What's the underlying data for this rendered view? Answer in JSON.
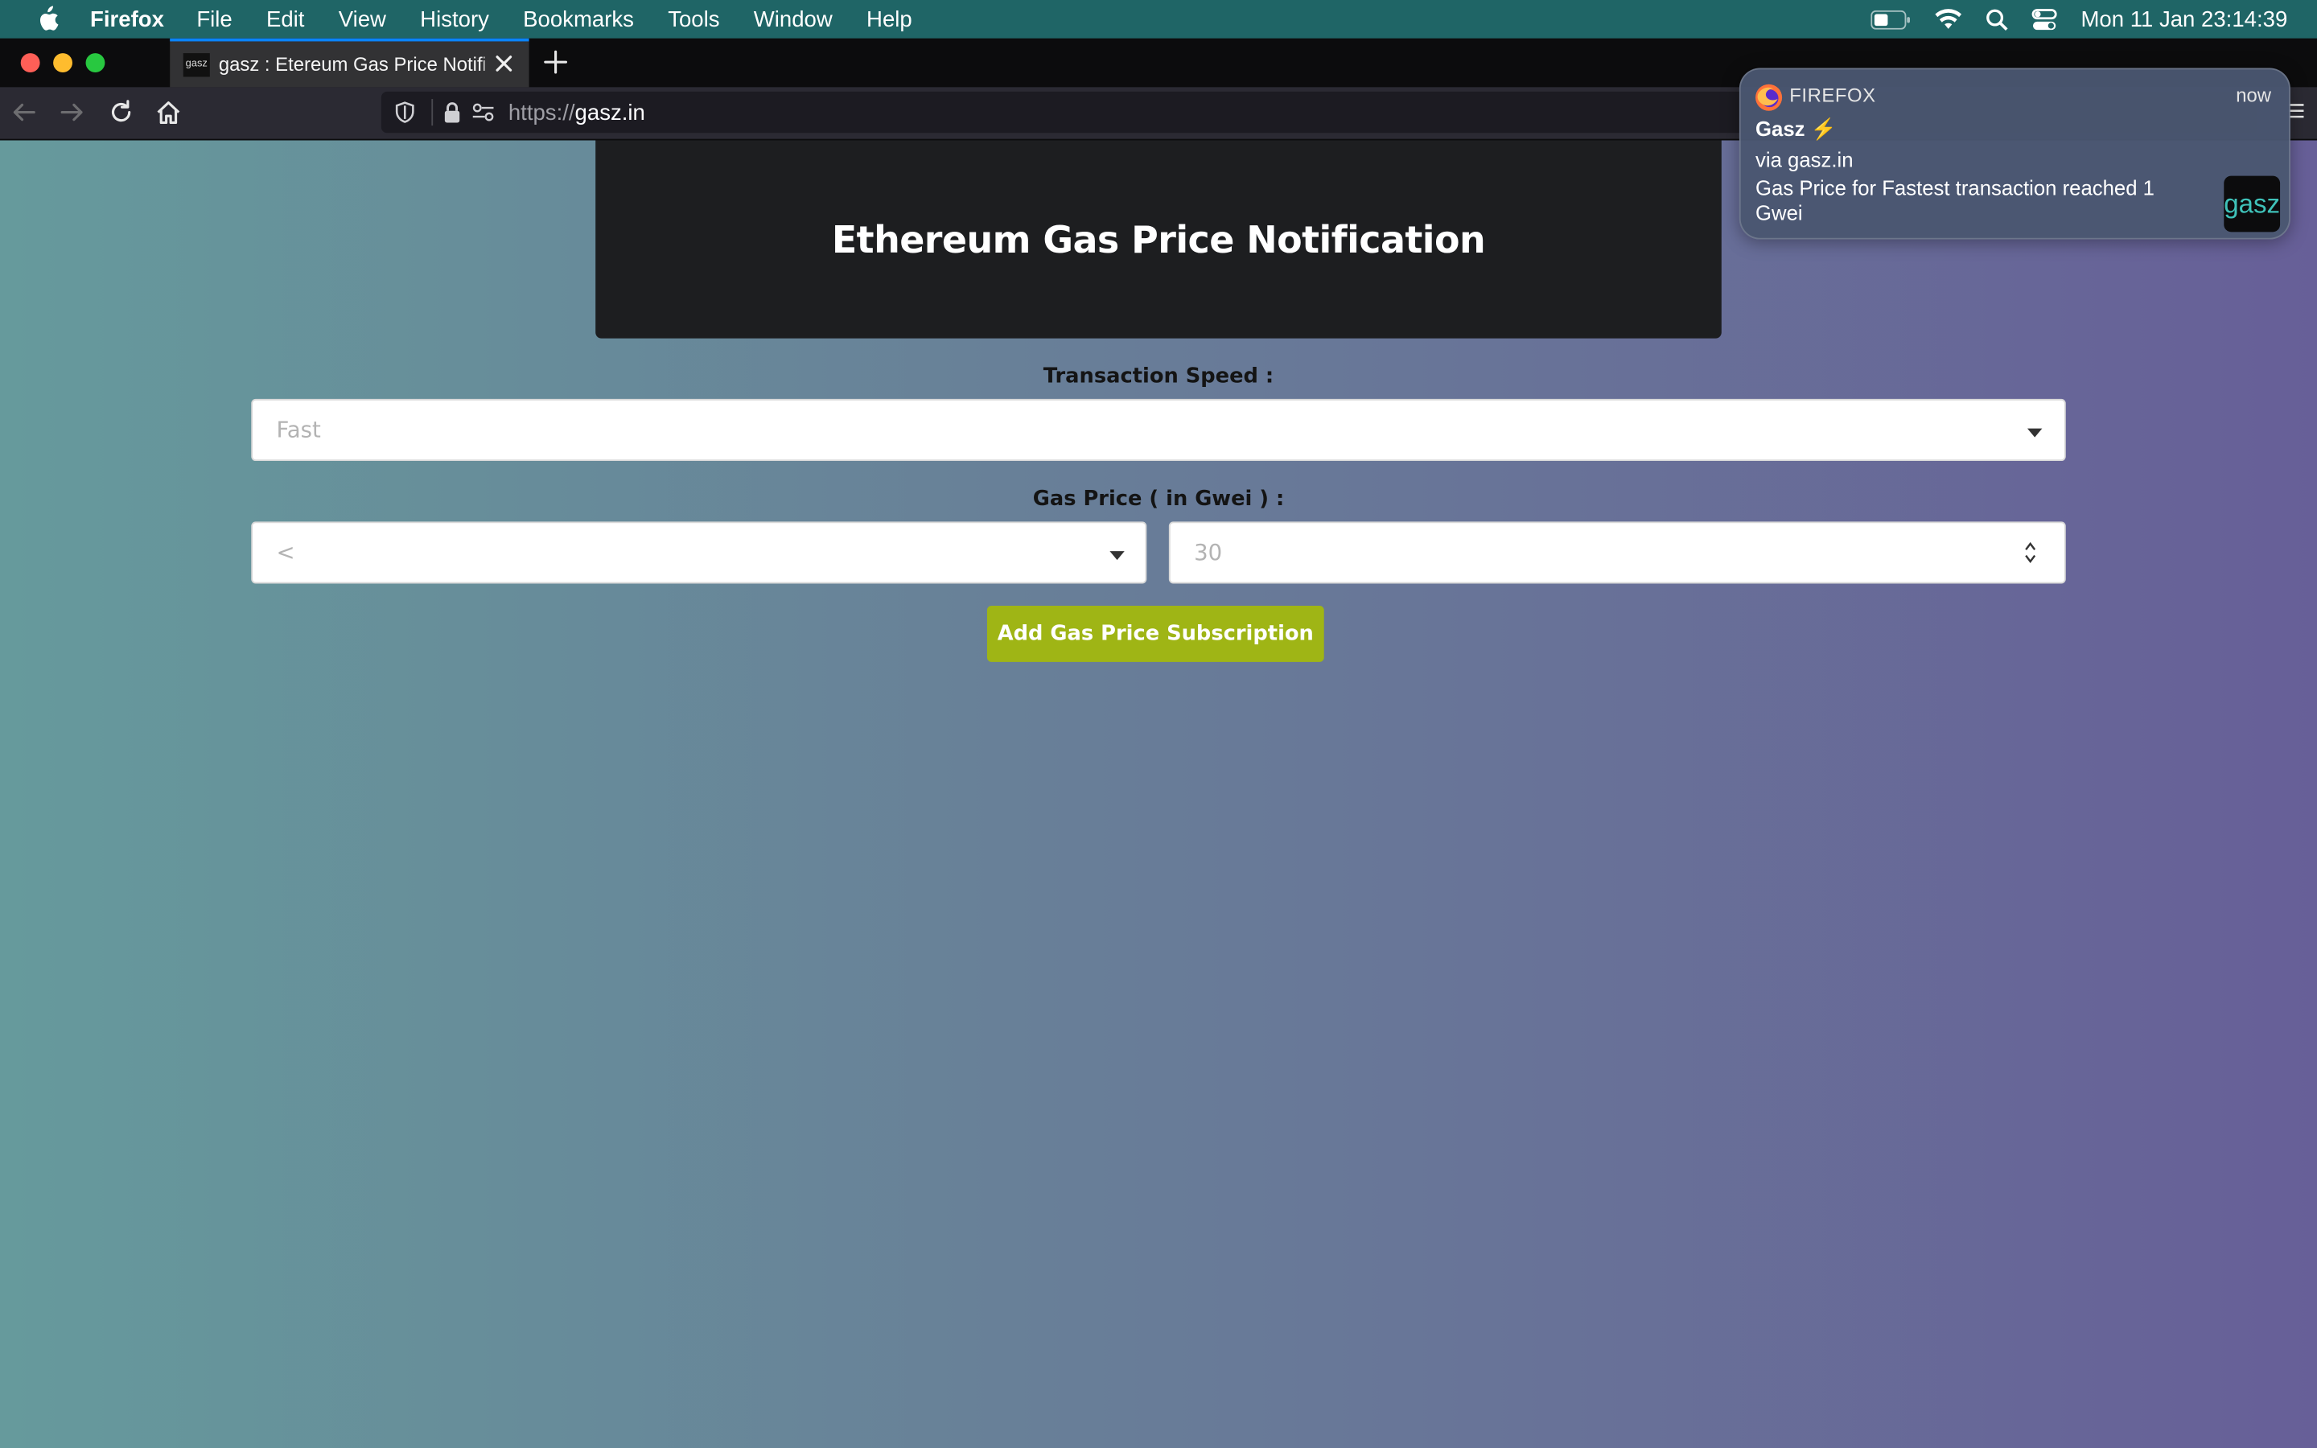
{
  "menubar": {
    "app_name": "Firefox",
    "items": [
      "File",
      "Edit",
      "View",
      "History",
      "Bookmarks",
      "Tools",
      "Window",
      "Help"
    ],
    "clock": "Mon 11 Jan  23:14:39"
  },
  "browser": {
    "tab_title": "gasz : Etereum Gas Price Notifi",
    "tab_favicon_text": "gasz",
    "url_protocol": "https://",
    "url_host": "gasz.in"
  },
  "page": {
    "heading": "Ethereum Gas Price Notification",
    "speed_label": "Transaction Speed :",
    "speed_value": "Fast",
    "price_label": "Gas Price ( in Gwei ) :",
    "comparator_value": "<",
    "price_value": "30",
    "add_button": "Add Gas Price Subscription"
  },
  "notification": {
    "app": "FIREFOX",
    "time": "now",
    "title": "Gasz",
    "title_emoji": "⚡",
    "via": "via gasz.in",
    "body": "Gas Price for Fastest transaction reached 1 Gwei",
    "thumb_text": "gasz"
  },
  "colors": {
    "menubar": "#1f6566",
    "accent_button": "#9fb515",
    "hero": "#1d1e20",
    "gradient_left": "#669a9c",
    "gradient_right": "#675f98"
  }
}
